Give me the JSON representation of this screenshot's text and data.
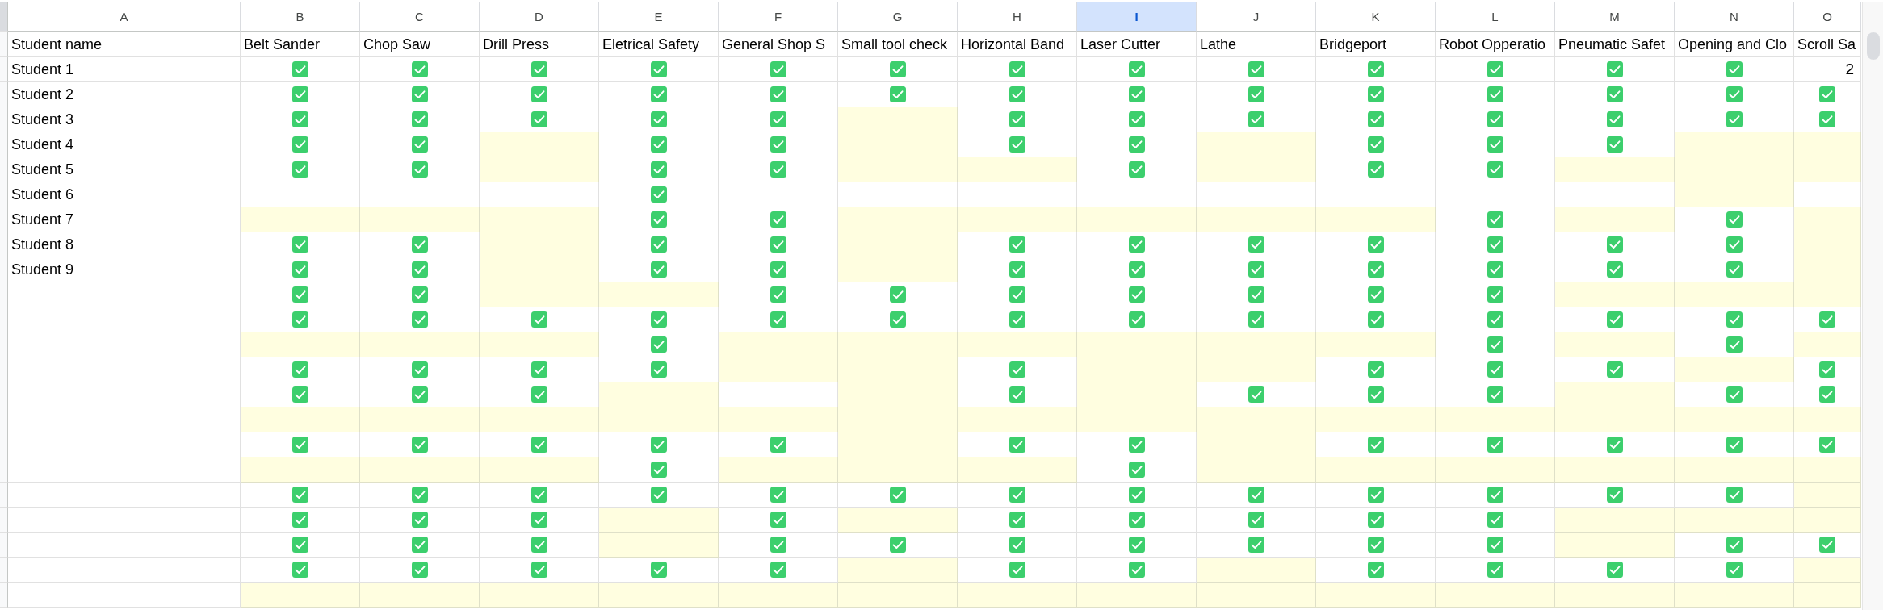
{
  "columns": [
    {
      "label": "A",
      "selected": false
    },
    {
      "label": "B",
      "selected": false
    },
    {
      "label": "C",
      "selected": false
    },
    {
      "label": "D",
      "selected": false
    },
    {
      "label": "E",
      "selected": false
    },
    {
      "label": "F",
      "selected": false
    },
    {
      "label": "G",
      "selected": false
    },
    {
      "label": "H",
      "selected": false
    },
    {
      "label": "I",
      "selected": true
    },
    {
      "label": "J",
      "selected": false
    },
    {
      "label": "K",
      "selected": false
    },
    {
      "label": "L",
      "selected": false
    },
    {
      "label": "M",
      "selected": false
    },
    {
      "label": "N",
      "selected": false
    },
    {
      "label": "O",
      "selected": false
    }
  ],
  "rows": [
    {
      "name": "Student name",
      "cells": [
        {
          "kind": "text",
          "text": "Belt Sander",
          "highlighted": false
        },
        {
          "kind": "text",
          "text": "Chop Saw",
          "highlighted": false
        },
        {
          "kind": "text",
          "text": "Drill Press",
          "highlighted": false
        },
        {
          "kind": "text",
          "text": "Eletrical Safety",
          "highlighted": false
        },
        {
          "kind": "text",
          "text": "General Shop S",
          "highlighted": false
        },
        {
          "kind": "text",
          "text": "Small tool check",
          "highlighted": false
        },
        {
          "kind": "text",
          "text": "Horizontal Band",
          "highlighted": false
        },
        {
          "kind": "text",
          "text": "Laser Cutter",
          "highlighted": false
        },
        {
          "kind": "text",
          "text": "Lathe",
          "highlighted": false
        },
        {
          "kind": "text",
          "text": "Bridgeport",
          "highlighted": false
        },
        {
          "kind": "text",
          "text": "Robot Opperatio",
          "highlighted": false
        },
        {
          "kind": "text",
          "text": "Pneumatic Safet",
          "highlighted": false
        },
        {
          "kind": "text",
          "text": "Opening and Clo",
          "highlighted": false
        },
        {
          "kind": "text",
          "text": "Scroll Sa",
          "highlighted": false
        }
      ]
    },
    {
      "name": "Student 1",
      "cells": [
        {
          "kind": "tick",
          "highlighted": false
        },
        {
          "kind": "tick",
          "highlighted": false
        },
        {
          "kind": "tick",
          "highlighted": false
        },
        {
          "kind": "tick",
          "highlighted": false
        },
        {
          "kind": "tick",
          "highlighted": false
        },
        {
          "kind": "tick",
          "highlighted": false
        },
        {
          "kind": "tick",
          "highlighted": false
        },
        {
          "kind": "tick",
          "highlighted": false
        },
        {
          "kind": "tick",
          "highlighted": false
        },
        {
          "kind": "tick",
          "highlighted": false
        },
        {
          "kind": "tick",
          "highlighted": false
        },
        {
          "kind": "tick",
          "highlighted": false
        },
        {
          "kind": "tick",
          "highlighted": false
        },
        {
          "kind": "number",
          "text": "2",
          "highlighted": false
        }
      ]
    },
    {
      "name": "Student 2",
      "cells": [
        {
          "kind": "tick",
          "highlighted": false
        },
        {
          "kind": "tick",
          "highlighted": false
        },
        {
          "kind": "tick",
          "highlighted": false
        },
        {
          "kind": "tick",
          "highlighted": false
        },
        {
          "kind": "tick",
          "highlighted": false
        },
        {
          "kind": "tick",
          "highlighted": false
        },
        {
          "kind": "tick",
          "highlighted": false
        },
        {
          "kind": "tick",
          "highlighted": false
        },
        {
          "kind": "tick",
          "highlighted": false
        },
        {
          "kind": "tick",
          "highlighted": false
        },
        {
          "kind": "tick",
          "highlighted": false
        },
        {
          "kind": "tick",
          "highlighted": false
        },
        {
          "kind": "tick",
          "highlighted": false
        },
        {
          "kind": "tick",
          "highlighted": false
        }
      ]
    },
    {
      "name": "Student 3",
      "cells": [
        {
          "kind": "tick",
          "highlighted": false
        },
        {
          "kind": "tick",
          "highlighted": false
        },
        {
          "kind": "tick",
          "highlighted": false
        },
        {
          "kind": "tick",
          "highlighted": false
        },
        {
          "kind": "tick",
          "highlighted": false
        },
        {
          "kind": "empty",
          "highlighted": true
        },
        {
          "kind": "tick",
          "highlighted": false
        },
        {
          "kind": "tick",
          "highlighted": false
        },
        {
          "kind": "tick",
          "highlighted": false
        },
        {
          "kind": "tick",
          "highlighted": false
        },
        {
          "kind": "tick",
          "highlighted": false
        },
        {
          "kind": "tick",
          "highlighted": false
        },
        {
          "kind": "tick",
          "highlighted": false
        },
        {
          "kind": "tick",
          "highlighted": false
        }
      ]
    },
    {
      "name": "Student 4",
      "cells": [
        {
          "kind": "tick",
          "highlighted": false
        },
        {
          "kind": "tick",
          "highlighted": false
        },
        {
          "kind": "empty",
          "highlighted": true
        },
        {
          "kind": "tick",
          "highlighted": false
        },
        {
          "kind": "tick",
          "highlighted": false
        },
        {
          "kind": "empty",
          "highlighted": true
        },
        {
          "kind": "tick",
          "highlighted": false
        },
        {
          "kind": "tick",
          "highlighted": false
        },
        {
          "kind": "empty",
          "highlighted": true
        },
        {
          "kind": "tick",
          "highlighted": false
        },
        {
          "kind": "tick",
          "highlighted": false
        },
        {
          "kind": "tick",
          "highlighted": false
        },
        {
          "kind": "empty",
          "highlighted": true
        },
        {
          "kind": "empty",
          "highlighted": true
        }
      ]
    },
    {
      "name": "Student 5",
      "cells": [
        {
          "kind": "tick",
          "highlighted": false
        },
        {
          "kind": "tick",
          "highlighted": false
        },
        {
          "kind": "empty",
          "highlighted": true
        },
        {
          "kind": "tick",
          "highlighted": false
        },
        {
          "kind": "tick",
          "highlighted": false
        },
        {
          "kind": "empty",
          "highlighted": true
        },
        {
          "kind": "empty",
          "highlighted": true
        },
        {
          "kind": "tick",
          "highlighted": false
        },
        {
          "kind": "empty",
          "highlighted": true
        },
        {
          "kind": "tick",
          "highlighted": false
        },
        {
          "kind": "tick",
          "highlighted": false
        },
        {
          "kind": "empty",
          "highlighted": true
        },
        {
          "kind": "empty",
          "highlighted": true
        },
        {
          "kind": "empty",
          "highlighted": true
        }
      ]
    },
    {
      "name": "Student 6",
      "cells": [
        {
          "kind": "empty",
          "highlighted": false
        },
        {
          "kind": "empty",
          "highlighted": false
        },
        {
          "kind": "empty",
          "highlighted": false
        },
        {
          "kind": "tick",
          "highlighted": false
        },
        {
          "kind": "empty",
          "highlighted": false
        },
        {
          "kind": "empty",
          "highlighted": false
        },
        {
          "kind": "empty",
          "highlighted": false
        },
        {
          "kind": "empty",
          "highlighted": false
        },
        {
          "kind": "empty",
          "highlighted": false
        },
        {
          "kind": "empty",
          "highlighted": false
        },
        {
          "kind": "empty",
          "highlighted": false
        },
        {
          "kind": "empty",
          "highlighted": false
        },
        {
          "kind": "empty",
          "highlighted": true
        },
        {
          "kind": "empty",
          "highlighted": false
        }
      ]
    },
    {
      "name": "Student 7",
      "cells": [
        {
          "kind": "empty",
          "highlighted": true
        },
        {
          "kind": "empty",
          "highlighted": true
        },
        {
          "kind": "empty",
          "highlighted": true
        },
        {
          "kind": "tick",
          "highlighted": false
        },
        {
          "kind": "tick",
          "highlighted": false
        },
        {
          "kind": "empty",
          "highlighted": true
        },
        {
          "kind": "empty",
          "highlighted": true
        },
        {
          "kind": "empty",
          "highlighted": true
        },
        {
          "kind": "empty",
          "highlighted": true
        },
        {
          "kind": "empty",
          "highlighted": true
        },
        {
          "kind": "tick",
          "highlighted": false
        },
        {
          "kind": "empty",
          "highlighted": true
        },
        {
          "kind": "tick",
          "highlighted": false
        },
        {
          "kind": "empty",
          "highlighted": true
        }
      ]
    },
    {
      "name": "Student 8",
      "cells": [
        {
          "kind": "tick",
          "highlighted": false
        },
        {
          "kind": "tick",
          "highlighted": false
        },
        {
          "kind": "empty",
          "highlighted": true
        },
        {
          "kind": "tick",
          "highlighted": false
        },
        {
          "kind": "tick",
          "highlighted": false
        },
        {
          "kind": "empty",
          "highlighted": true
        },
        {
          "kind": "tick",
          "highlighted": false
        },
        {
          "kind": "tick",
          "highlighted": false
        },
        {
          "kind": "tick",
          "highlighted": false
        },
        {
          "kind": "tick",
          "highlighted": false
        },
        {
          "kind": "tick",
          "highlighted": false
        },
        {
          "kind": "tick",
          "highlighted": false
        },
        {
          "kind": "tick",
          "highlighted": false
        },
        {
          "kind": "empty",
          "highlighted": true
        }
      ]
    },
    {
      "name": "Student 9",
      "cells": [
        {
          "kind": "tick",
          "highlighted": false
        },
        {
          "kind": "tick",
          "highlighted": false
        },
        {
          "kind": "empty",
          "highlighted": true
        },
        {
          "kind": "tick",
          "highlighted": false
        },
        {
          "kind": "tick",
          "highlighted": false
        },
        {
          "kind": "empty",
          "highlighted": true
        },
        {
          "kind": "tick",
          "highlighted": false
        },
        {
          "kind": "tick",
          "highlighted": false
        },
        {
          "kind": "tick",
          "highlighted": false
        },
        {
          "kind": "tick",
          "highlighted": false
        },
        {
          "kind": "tick",
          "highlighted": false
        },
        {
          "kind": "tick",
          "highlighted": false
        },
        {
          "kind": "tick",
          "highlighted": false
        },
        {
          "kind": "empty",
          "highlighted": true
        }
      ]
    },
    {
      "cells": [
        {
          "kind": "tick",
          "highlighted": false
        },
        {
          "kind": "tick",
          "highlighted": false
        },
        {
          "kind": "empty",
          "highlighted": true
        },
        {
          "kind": "empty",
          "highlighted": true
        },
        {
          "kind": "tick",
          "highlighted": false
        },
        {
          "kind": "tick",
          "highlighted": false
        },
        {
          "kind": "tick",
          "highlighted": false
        },
        {
          "kind": "tick",
          "highlighted": false
        },
        {
          "kind": "tick",
          "highlighted": false
        },
        {
          "kind": "tick",
          "highlighted": false
        },
        {
          "kind": "tick",
          "highlighted": false
        },
        {
          "kind": "empty",
          "highlighted": true
        },
        {
          "kind": "empty",
          "highlighted": true
        },
        {
          "kind": "empty",
          "highlighted": true
        }
      ]
    },
    {
      "cells": [
        {
          "kind": "tick",
          "highlighted": false
        },
        {
          "kind": "tick",
          "highlighted": false
        },
        {
          "kind": "tick",
          "highlighted": false
        },
        {
          "kind": "tick",
          "highlighted": false
        },
        {
          "kind": "tick",
          "highlighted": false
        },
        {
          "kind": "tick",
          "highlighted": false
        },
        {
          "kind": "tick",
          "highlighted": false
        },
        {
          "kind": "tick",
          "highlighted": false
        },
        {
          "kind": "tick",
          "highlighted": false
        },
        {
          "kind": "tick",
          "highlighted": false
        },
        {
          "kind": "tick",
          "highlighted": false
        },
        {
          "kind": "tick",
          "highlighted": false
        },
        {
          "kind": "tick",
          "highlighted": false
        },
        {
          "kind": "tick",
          "highlighted": false
        }
      ]
    },
    {
      "cells": [
        {
          "kind": "empty",
          "highlighted": true
        },
        {
          "kind": "empty",
          "highlighted": true
        },
        {
          "kind": "empty",
          "highlighted": true
        },
        {
          "kind": "tick",
          "highlighted": false
        },
        {
          "kind": "empty",
          "highlighted": true
        },
        {
          "kind": "empty",
          "highlighted": true
        },
        {
          "kind": "empty",
          "highlighted": true
        },
        {
          "kind": "empty",
          "highlighted": true
        },
        {
          "kind": "empty",
          "highlighted": true
        },
        {
          "kind": "empty",
          "highlighted": true
        },
        {
          "kind": "tick",
          "highlighted": false
        },
        {
          "kind": "empty",
          "highlighted": true
        },
        {
          "kind": "tick",
          "highlighted": false
        },
        {
          "kind": "empty",
          "highlighted": true
        }
      ]
    },
    {
      "cells": [
        {
          "kind": "tick",
          "highlighted": false
        },
        {
          "kind": "tick",
          "highlighted": false
        },
        {
          "kind": "tick",
          "highlighted": false
        },
        {
          "kind": "tick",
          "highlighted": false
        },
        {
          "kind": "empty",
          "highlighted": true
        },
        {
          "kind": "empty",
          "highlighted": true
        },
        {
          "kind": "tick",
          "highlighted": false
        },
        {
          "kind": "empty",
          "highlighted": true
        },
        {
          "kind": "empty",
          "highlighted": true
        },
        {
          "kind": "tick",
          "highlighted": false
        },
        {
          "kind": "tick",
          "highlighted": false
        },
        {
          "kind": "tick",
          "highlighted": false
        },
        {
          "kind": "empty",
          "highlighted": true
        },
        {
          "kind": "tick",
          "highlighted": false
        }
      ]
    },
    {
      "cells": [
        {
          "kind": "tick",
          "highlighted": false
        },
        {
          "kind": "tick",
          "highlighted": false
        },
        {
          "kind": "tick",
          "highlighted": false
        },
        {
          "kind": "empty",
          "highlighted": true
        },
        {
          "kind": "empty",
          "highlighted": false
        },
        {
          "kind": "empty",
          "highlighted": true
        },
        {
          "kind": "tick",
          "highlighted": false
        },
        {
          "kind": "empty",
          "highlighted": true
        },
        {
          "kind": "tick",
          "highlighted": false
        },
        {
          "kind": "tick",
          "highlighted": false
        },
        {
          "kind": "tick",
          "highlighted": false
        },
        {
          "kind": "empty",
          "highlighted": true
        },
        {
          "kind": "tick",
          "highlighted": false
        },
        {
          "kind": "tick",
          "highlighted": false
        }
      ]
    },
    {
      "cells": [
        {
          "kind": "empty",
          "highlighted": true
        },
        {
          "kind": "empty",
          "highlighted": true
        },
        {
          "kind": "empty",
          "highlighted": true
        },
        {
          "kind": "empty",
          "highlighted": true
        },
        {
          "kind": "empty",
          "highlighted": true
        },
        {
          "kind": "empty",
          "highlighted": true
        },
        {
          "kind": "empty",
          "highlighted": true
        },
        {
          "kind": "empty",
          "highlighted": true
        },
        {
          "kind": "empty",
          "highlighted": true
        },
        {
          "kind": "empty",
          "highlighted": true
        },
        {
          "kind": "empty",
          "highlighted": true
        },
        {
          "kind": "empty",
          "highlighted": true
        },
        {
          "kind": "empty",
          "highlighted": true
        },
        {
          "kind": "empty",
          "highlighted": true
        }
      ]
    },
    {
      "cells": [
        {
          "kind": "tick",
          "highlighted": false
        },
        {
          "kind": "tick",
          "highlighted": false
        },
        {
          "kind": "tick",
          "highlighted": false
        },
        {
          "kind": "tick",
          "highlighted": false
        },
        {
          "kind": "tick",
          "highlighted": false
        },
        {
          "kind": "empty",
          "highlighted": true
        },
        {
          "kind": "tick",
          "highlighted": false
        },
        {
          "kind": "tick",
          "highlighted": false
        },
        {
          "kind": "empty",
          "highlighted": true
        },
        {
          "kind": "tick",
          "highlighted": false
        },
        {
          "kind": "tick",
          "highlighted": false
        },
        {
          "kind": "tick",
          "highlighted": false
        },
        {
          "kind": "tick",
          "highlighted": false
        },
        {
          "kind": "tick",
          "highlighted": false
        }
      ]
    },
    {
      "cells": [
        {
          "kind": "empty",
          "highlighted": true
        },
        {
          "kind": "empty",
          "highlighted": true
        },
        {
          "kind": "empty",
          "highlighted": true
        },
        {
          "kind": "tick",
          "highlighted": false
        },
        {
          "kind": "empty",
          "highlighted": true
        },
        {
          "kind": "empty",
          "highlighted": true
        },
        {
          "kind": "empty",
          "highlighted": true
        },
        {
          "kind": "tick",
          "highlighted": false
        },
        {
          "kind": "empty",
          "highlighted": true
        },
        {
          "kind": "empty",
          "highlighted": true
        },
        {
          "kind": "empty",
          "highlighted": true
        },
        {
          "kind": "empty",
          "highlighted": true
        },
        {
          "kind": "empty",
          "highlighted": true
        },
        {
          "kind": "empty",
          "highlighted": true
        }
      ]
    },
    {
      "cells": [
        {
          "kind": "tick",
          "highlighted": false
        },
        {
          "kind": "tick",
          "highlighted": false
        },
        {
          "kind": "tick",
          "highlighted": false
        },
        {
          "kind": "tick",
          "highlighted": false
        },
        {
          "kind": "tick",
          "highlighted": false
        },
        {
          "kind": "tick",
          "highlighted": false
        },
        {
          "kind": "tick",
          "highlighted": false
        },
        {
          "kind": "tick",
          "highlighted": false
        },
        {
          "kind": "tick",
          "highlighted": false
        },
        {
          "kind": "tick",
          "highlighted": false
        },
        {
          "kind": "tick",
          "highlighted": false
        },
        {
          "kind": "tick",
          "highlighted": false
        },
        {
          "kind": "tick",
          "highlighted": false
        },
        {
          "kind": "empty",
          "highlighted": true
        }
      ]
    },
    {
      "cells": [
        {
          "kind": "tick",
          "highlighted": false
        },
        {
          "kind": "tick",
          "highlighted": false
        },
        {
          "kind": "tick",
          "highlighted": false
        },
        {
          "kind": "empty",
          "highlighted": true
        },
        {
          "kind": "tick",
          "highlighted": false
        },
        {
          "kind": "empty",
          "highlighted": true
        },
        {
          "kind": "tick",
          "highlighted": false
        },
        {
          "kind": "tick",
          "highlighted": false
        },
        {
          "kind": "tick",
          "highlighted": false
        },
        {
          "kind": "tick",
          "highlighted": false
        },
        {
          "kind": "tick",
          "highlighted": false
        },
        {
          "kind": "empty",
          "highlighted": true
        },
        {
          "kind": "empty",
          "highlighted": true
        },
        {
          "kind": "empty",
          "highlighted": true
        }
      ]
    },
    {
      "cells": [
        {
          "kind": "tick",
          "highlighted": false
        },
        {
          "kind": "tick",
          "highlighted": false
        },
        {
          "kind": "tick",
          "highlighted": false
        },
        {
          "kind": "empty",
          "highlighted": true
        },
        {
          "kind": "tick",
          "highlighted": false
        },
        {
          "kind": "tick",
          "highlighted": false
        },
        {
          "kind": "tick",
          "highlighted": false
        },
        {
          "kind": "tick",
          "highlighted": false
        },
        {
          "kind": "tick",
          "highlighted": false
        },
        {
          "kind": "tick",
          "highlighted": false
        },
        {
          "kind": "tick",
          "highlighted": false
        },
        {
          "kind": "empty",
          "highlighted": true
        },
        {
          "kind": "tick",
          "highlighted": false
        },
        {
          "kind": "tick",
          "highlighted": false
        }
      ]
    },
    {
      "cells": [
        {
          "kind": "tick",
          "highlighted": false
        },
        {
          "kind": "tick",
          "highlighted": false
        },
        {
          "kind": "tick",
          "highlighted": false
        },
        {
          "kind": "tick",
          "highlighted": false
        },
        {
          "kind": "tick",
          "highlighted": false
        },
        {
          "kind": "empty",
          "highlighted": true
        },
        {
          "kind": "tick",
          "highlighted": false
        },
        {
          "kind": "tick",
          "highlighted": false
        },
        {
          "kind": "empty",
          "highlighted": true
        },
        {
          "kind": "tick",
          "highlighted": false
        },
        {
          "kind": "tick",
          "highlighted": false
        },
        {
          "kind": "tick",
          "highlighted": false
        },
        {
          "kind": "tick",
          "highlighted": false
        },
        {
          "kind": "empty",
          "highlighted": true
        }
      ]
    },
    {
      "cells": [
        {
          "kind": "empty",
          "highlighted": true
        },
        {
          "kind": "empty",
          "highlighted": true
        },
        {
          "kind": "empty",
          "highlighted": true
        },
        {
          "kind": "empty",
          "highlighted": true
        },
        {
          "kind": "empty",
          "highlighted": true
        },
        {
          "kind": "empty",
          "highlighted": true
        },
        {
          "kind": "empty",
          "highlighted": true
        },
        {
          "kind": "empty",
          "highlighted": true
        },
        {
          "kind": "empty",
          "highlighted": true
        },
        {
          "kind": "empty",
          "highlighted": true
        },
        {
          "kind": "empty",
          "highlighted": true
        },
        {
          "kind": "empty",
          "highlighted": true
        },
        {
          "kind": "empty",
          "highlighted": true
        },
        {
          "kind": "empty",
          "highlighted": true
        }
      ]
    }
  ]
}
